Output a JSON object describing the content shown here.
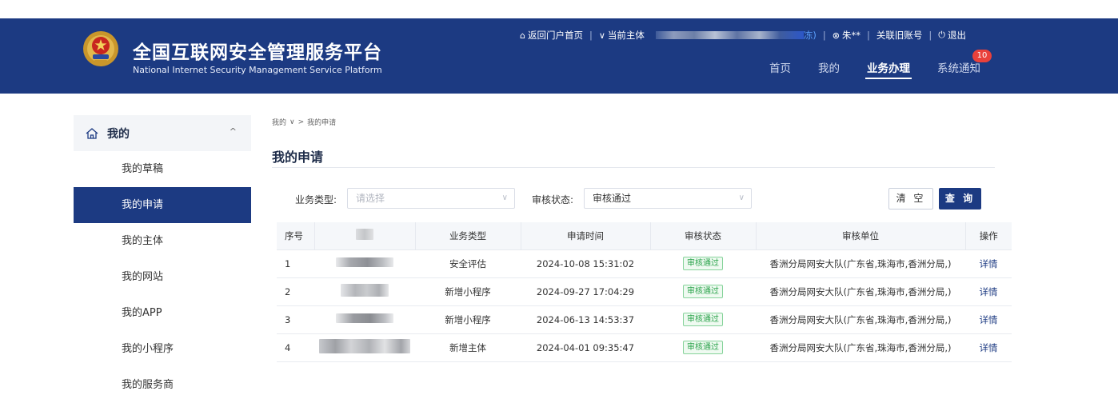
{
  "header": {
    "title_cn": "全国互联网安全管理服务平台",
    "title_en": "National Internet Security Management Service Platform",
    "top_links": {
      "home": "返回门户首页",
      "subject_label": "当前主体",
      "subject_tail": "冻)",
      "user": "朱**",
      "link_account": "关联旧账号",
      "logout": "退出"
    },
    "nav": [
      {
        "label": "首页"
      },
      {
        "label": "我的"
      },
      {
        "label": "业务办理"
      },
      {
        "label": "系统通知"
      }
    ],
    "notification_count": "10"
  },
  "sidebar": {
    "section_title": "我的",
    "items": [
      {
        "label": "我的草稿"
      },
      {
        "label": "我的申请"
      },
      {
        "label": "我的主体"
      },
      {
        "label": "我的网站"
      },
      {
        "label": "我的APP"
      },
      {
        "label": "我的小程序"
      },
      {
        "label": "我的服务商"
      }
    ]
  },
  "breadcrumb": {
    "root": "我的",
    "current": "我的申请"
  },
  "page": {
    "title": "我的申请"
  },
  "filters": {
    "business_type_label": "业务类型:",
    "business_type_placeholder": "请选择",
    "status_label": "审核状态:",
    "status_value": "审核通过",
    "clear_label": "清 空",
    "query_label": "查 询"
  },
  "table": {
    "headers": [
      "序号",
      "",
      "业务类型",
      "申请时间",
      "审核状态",
      "审核单位",
      "操作"
    ],
    "rows": [
      {
        "index": "1",
        "type": "安全评估",
        "time": "2024-10-08 15:31:02",
        "status": "审核通过",
        "unit": "香洲分局网安大队(广东省,珠海市,香洲分局,)",
        "action": "详情"
      },
      {
        "index": "2",
        "type": "新增小程序",
        "time": "2024-09-27 17:04:29",
        "status": "审核通过",
        "unit": "香洲分局网安大队(广东省,珠海市,香洲分局,)",
        "action": "详情"
      },
      {
        "index": "3",
        "type": "新增小程序",
        "time": "2024-06-13 14:53:37",
        "status": "审核通过",
        "unit": "香洲分局网安大队(广东省,珠海市,香洲分局,)",
        "action": "详情"
      },
      {
        "index": "4",
        "type": "新增主体",
        "time": "2024-04-01 09:35:47",
        "status": "审核通过",
        "unit": "香洲分局网安大队(广东省,珠海市,香洲分局,)",
        "action": "详情"
      }
    ]
  },
  "colors": {
    "brand": "#1c3a82",
    "badge": "#e9413b",
    "status_green": "#2aa34a"
  },
  "icons": [
    "police-emblem-icon",
    "home-icon",
    "chevron-down-icon",
    "user-icon",
    "power-icon",
    "chevron-up-icon"
  ]
}
